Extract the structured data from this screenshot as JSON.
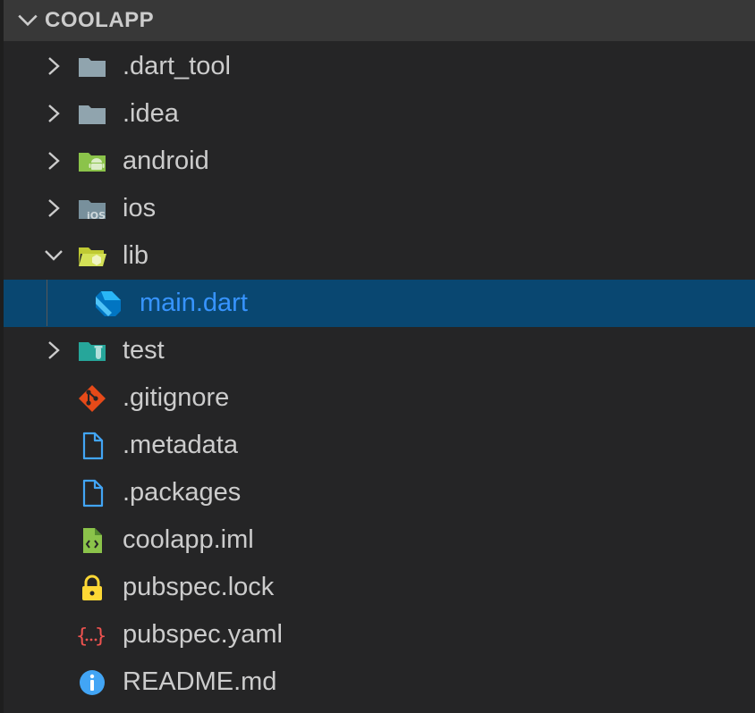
{
  "explorer": {
    "title": "COOLAPP",
    "items": [
      {
        "label": ".dart_tool",
        "type": "folder",
        "expanded": false,
        "icon": "folder-grey-icon"
      },
      {
        "label": ".idea",
        "type": "folder",
        "expanded": false,
        "icon": "folder-grey-icon"
      },
      {
        "label": "android",
        "type": "folder",
        "expanded": false,
        "icon": "folder-android-icon"
      },
      {
        "label": "ios",
        "type": "folder",
        "expanded": false,
        "icon": "folder-ios-icon"
      },
      {
        "label": "lib",
        "type": "folder",
        "expanded": true,
        "icon": "folder-lib-open-icon"
      },
      {
        "label": "main.dart",
        "type": "file",
        "selected": true,
        "icon": "dart-icon"
      },
      {
        "label": "test",
        "type": "folder",
        "expanded": false,
        "icon": "folder-test-icon"
      },
      {
        "label": ".gitignore",
        "type": "file",
        "icon": "git-icon"
      },
      {
        "label": ".metadata",
        "type": "file",
        "icon": "file-icon"
      },
      {
        "label": ".packages",
        "type": "file",
        "icon": "file-icon"
      },
      {
        "label": "coolapp.iml",
        "type": "file",
        "icon": "xml-file-icon"
      },
      {
        "label": "pubspec.lock",
        "type": "file",
        "icon": "lock-icon"
      },
      {
        "label": "pubspec.yaml",
        "type": "file",
        "icon": "yaml-icon"
      },
      {
        "label": "README.md",
        "type": "file",
        "icon": "info-icon"
      }
    ]
  },
  "colors": {
    "background": "#252526",
    "header": "#383838",
    "text": "#cccccc",
    "selection": "#094771",
    "selected_text": "#3794ff"
  }
}
